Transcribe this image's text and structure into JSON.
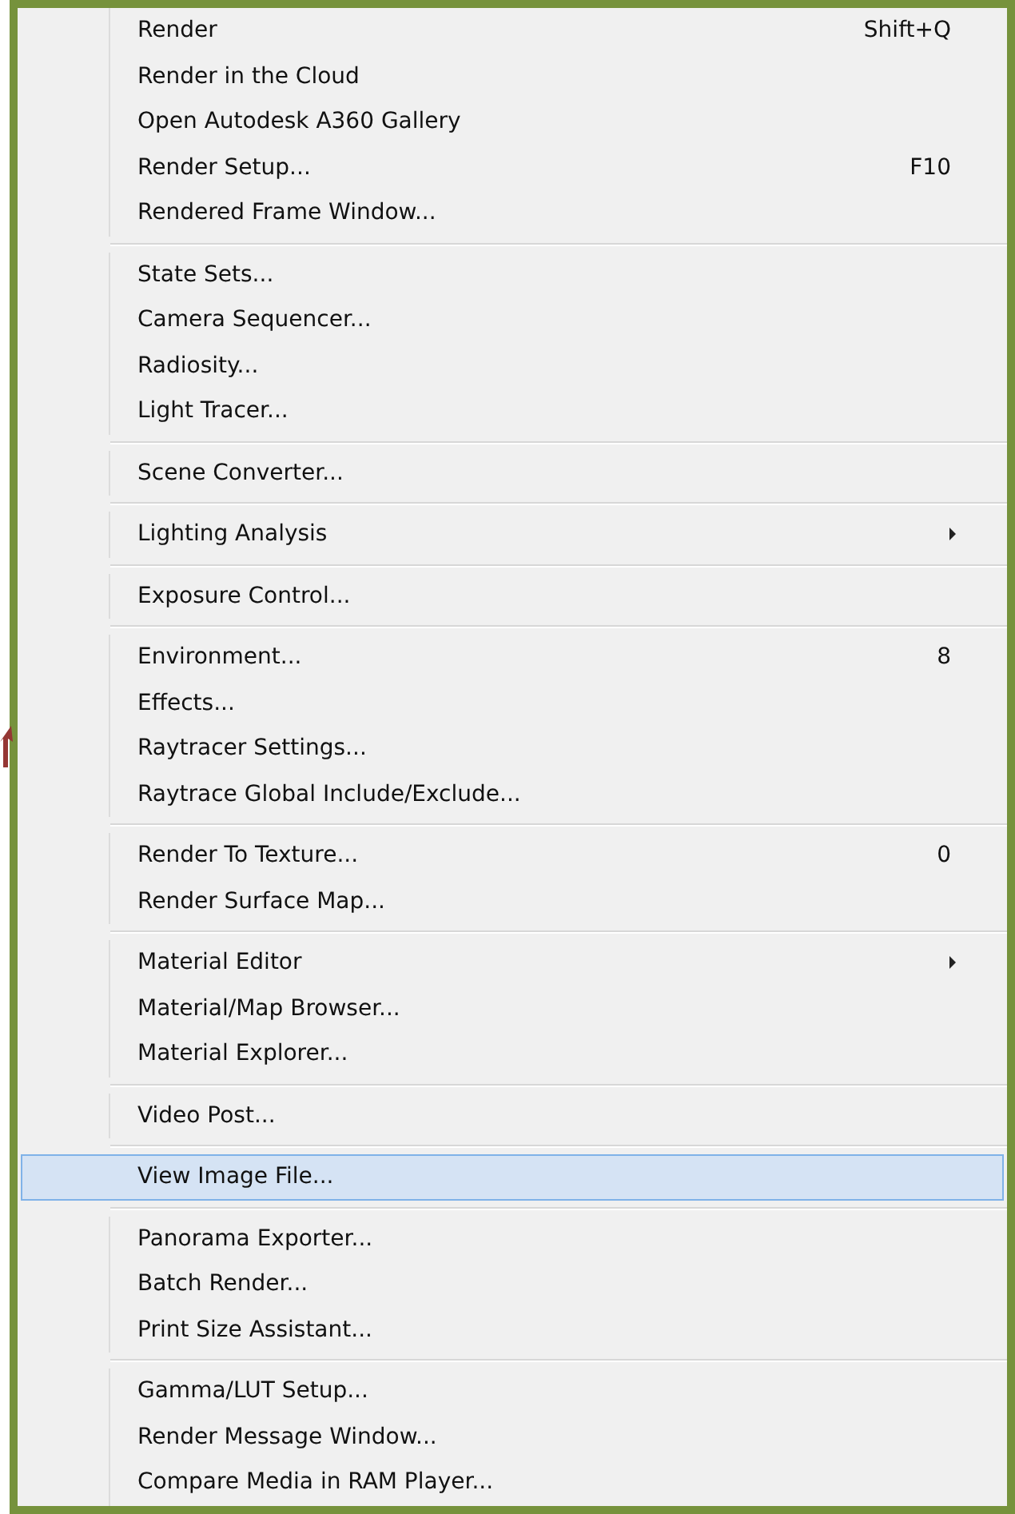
{
  "menu": {
    "groups": [
      {
        "items": [
          {
            "label": "Render",
            "shortcut": "Shift+Q",
            "submenu": false,
            "selected": false
          },
          {
            "label": "Render in the Cloud",
            "submenu": false,
            "selected": false
          },
          {
            "label": "Open Autodesk A360 Gallery",
            "submenu": false,
            "selected": false
          },
          {
            "label": "Render Setup...",
            "shortcut": "F10",
            "submenu": false,
            "selected": false
          },
          {
            "label": "Rendered Frame Window...",
            "submenu": false,
            "selected": false
          }
        ]
      },
      {
        "items": [
          {
            "label": "State Sets...",
            "submenu": false,
            "selected": false
          },
          {
            "label": "Camera Sequencer...",
            "submenu": false,
            "selected": false
          },
          {
            "label": "Radiosity...",
            "submenu": false,
            "selected": false
          },
          {
            "label": "Light Tracer...",
            "submenu": false,
            "selected": false
          }
        ]
      },
      {
        "items": [
          {
            "label": "Scene Converter...",
            "submenu": false,
            "selected": false
          }
        ]
      },
      {
        "items": [
          {
            "label": "Lighting Analysis",
            "submenu": true,
            "selected": false
          }
        ]
      },
      {
        "items": [
          {
            "label": "Exposure Control...",
            "submenu": false,
            "selected": false
          }
        ]
      },
      {
        "items": [
          {
            "label": "Environment...",
            "shortcut": "8",
            "submenu": false,
            "selected": false
          },
          {
            "label": "Effects...",
            "submenu": false,
            "selected": false
          },
          {
            "label": "Raytracer Settings...",
            "submenu": false,
            "selected": false
          },
          {
            "label": "Raytrace Global Include/Exclude...",
            "submenu": false,
            "selected": false
          }
        ]
      },
      {
        "items": [
          {
            "label": "Render To Texture...",
            "shortcut": "0",
            "submenu": false,
            "selected": false
          },
          {
            "label": "Render Surface Map...",
            "submenu": false,
            "selected": false
          }
        ]
      },
      {
        "items": [
          {
            "label": "Material Editor",
            "submenu": true,
            "selected": false
          },
          {
            "label": "Material/Map Browser...",
            "submenu": false,
            "selected": false
          },
          {
            "label": "Material Explorer...",
            "submenu": false,
            "selected": false
          }
        ]
      },
      {
        "items": [
          {
            "label": "Video Post...",
            "submenu": false,
            "selected": false
          }
        ]
      },
      {
        "items": [
          {
            "label": "View Image File...",
            "submenu": false,
            "selected": true
          }
        ]
      },
      {
        "items": [
          {
            "label": "Panorama Exporter...",
            "submenu": false,
            "selected": false
          },
          {
            "label": "Batch Render...",
            "submenu": false,
            "selected": false
          },
          {
            "label": "Print Size Assistant...",
            "submenu": false,
            "selected": false
          }
        ]
      },
      {
        "items": [
          {
            "label": "Gamma/LUT Setup...",
            "submenu": false,
            "selected": false
          },
          {
            "label": "Render Message Window...",
            "submenu": false,
            "selected": false
          },
          {
            "label": "Compare Media in RAM Player...",
            "submenu": false,
            "selected": false
          }
        ]
      }
    ]
  }
}
